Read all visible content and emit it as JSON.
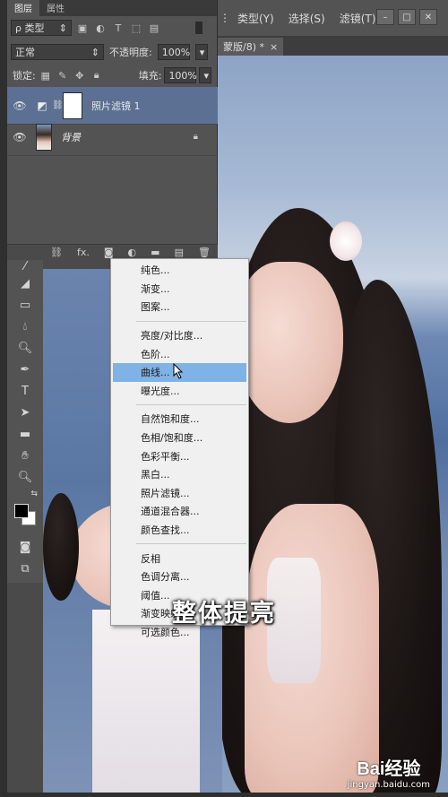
{
  "menubar": {
    "items": [
      "类型(Y)",
      "选择(S)",
      "滤镜(T)"
    ]
  },
  "doc_tab": {
    "label": "蒙版/8) *",
    "close": "×"
  },
  "panel": {
    "tabs": [
      "图层",
      "属性"
    ],
    "filter_kind": "ρ 类型",
    "blend_mode": "正常",
    "opacity_label": "不透明度:",
    "opacity_value": "100%",
    "lock_label": "锁定:",
    "fill_label": "填充:",
    "fill_value": "100%",
    "layers": [
      {
        "name": "照片滤镜 1",
        "selected": true
      },
      {
        "name": "背景",
        "selected": false
      }
    ],
    "bottom_icons": [
      "link-icon",
      "fx-icon",
      "mask-icon",
      "adjustment-icon",
      "folder-icon",
      "new-layer-icon",
      "trash-icon"
    ],
    "fx_label": "fx."
  },
  "adjust_menu": {
    "groups": [
      [
        "纯色...",
        "渐变...",
        "图案..."
      ],
      [
        "亮度/对比度...",
        "色阶...",
        "曲线...",
        "曝光度..."
      ],
      [
        "自然饱和度...",
        "色相/饱和度...",
        "色彩平衡...",
        "黑白...",
        "照片滤镜...",
        "通道混合器...",
        "颜色查找..."
      ],
      [
        "反相",
        "色调分离...",
        "阈值...",
        "渐变映射...",
        "可选颜色..."
      ]
    ],
    "highlighted": "曲线..."
  },
  "subtitle": "整体提亮",
  "watermark": {
    "logo": "Bai经验",
    "url": "jingyan.baidu.com"
  },
  "colors": {
    "panel": "#535353",
    "highlight": "#7fb2e5",
    "menu_bg": "#f0f0f0"
  }
}
